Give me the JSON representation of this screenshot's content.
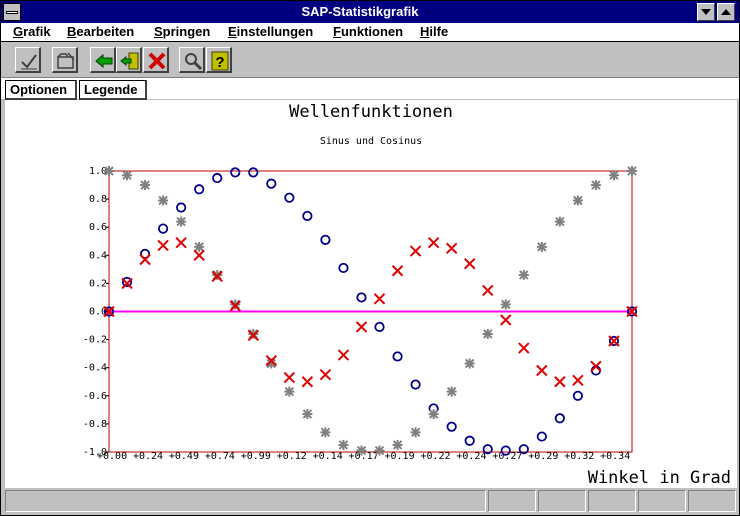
{
  "window": {
    "title": "SAP-Statistikgrafik"
  },
  "menu": [
    {
      "label": "Grafik",
      "accel": "G",
      "rest": "rafik"
    },
    {
      "label": "Bearbeiten",
      "accel": "B",
      "rest": "earbeiten"
    },
    {
      "label": "Springen",
      "accel": "S",
      "rest": "pringen"
    },
    {
      "label": "Einstellungen",
      "accel": "E",
      "rest": "instellungen"
    },
    {
      "label": "Funktionen",
      "accel": "F",
      "rest": "unktionen"
    },
    {
      "label": "Hilfe",
      "accel": "H",
      "rest": "ilfe"
    }
  ],
  "toolbar": {
    "icons": [
      "checkmark-icon",
      "folder-icon",
      "back-arrow-icon",
      "exit-icon",
      "cancel-icon",
      "find-icon",
      "help-icon"
    ],
    "colors": {
      "back": "#00a000",
      "exit": "#c0c000",
      "cancel": "#d00000",
      "help": "#c0c000"
    }
  },
  "tabs": {
    "options": "Optionen",
    "legend": "Legende"
  },
  "chart_data": {
    "type": "scatter",
    "title": "Wellenfunktionen",
    "subtitle": "Sinus und Cosinus",
    "xlabel": "Winkel in Grad",
    "ylabel": "",
    "ylim": [
      -1,
      1
    ],
    "yticks": [
      "1.0",
      "0.8",
      "0.6",
      "0.4",
      "0.2",
      "0.0",
      "-0.2",
      "-0.4",
      "-0.6",
      "-0.8",
      "-1.0"
    ],
    "xticks": [
      "+0.00",
      "+0.24",
      "+0.49",
      "+0.74",
      "+0.99",
      "+0.12",
      "+0.14",
      "+0.17",
      "+0.19",
      "+0.22",
      "+0.24",
      "+0.27",
      "+0.29",
      "+0.32",
      "+0.34"
    ],
    "x_count": 30,
    "grid": false,
    "legend": "none",
    "series": [
      {
        "marker": "circle",
        "color": "#00008b",
        "values": [
          0,
          0.21,
          0.41,
          0.59,
          0.74,
          0.87,
          0.95,
          0.99,
          0.99,
          0.91,
          0.81,
          0.68,
          0.51,
          0.31,
          0.1,
          -0.11,
          -0.32,
          -0.52,
          -0.69,
          -0.82,
          -0.92,
          -0.98,
          -0.99,
          -0.98,
          -0.89,
          -0.76,
          -0.6,
          -0.42,
          -0.21,
          0
        ]
      },
      {
        "marker": "asterisk",
        "color": "#808080",
        "values": [
          1,
          0.97,
          0.9,
          0.79,
          0.64,
          0.46,
          0.26,
          0.05,
          -0.16,
          -0.37,
          -0.57,
          -0.73,
          -0.86,
          -0.95,
          -0.99,
          -0.99,
          -0.95,
          -0.86,
          -0.73,
          -0.57,
          -0.37,
          -0.16,
          0.05,
          0.26,
          0.46,
          0.64,
          0.79,
          0.9,
          0.97,
          1
        ]
      },
      {
        "marker": "x",
        "color": "#e00000",
        "values": [
          0,
          0.2,
          0.37,
          0.47,
          0.49,
          0.4,
          0.25,
          0.04,
          -0.17,
          -0.35,
          -0.47,
          -0.5,
          -0.45,
          -0.31,
          -0.11,
          0.09,
          0.29,
          0.43,
          0.49,
          0.45,
          0.34,
          0.15,
          -0.06,
          -0.26,
          -0.42,
          -0.5,
          -0.49,
          -0.39,
          -0.21,
          0
        ]
      }
    ],
    "zero_line_color": "#ff00ff",
    "frame_color": "#c00000"
  }
}
